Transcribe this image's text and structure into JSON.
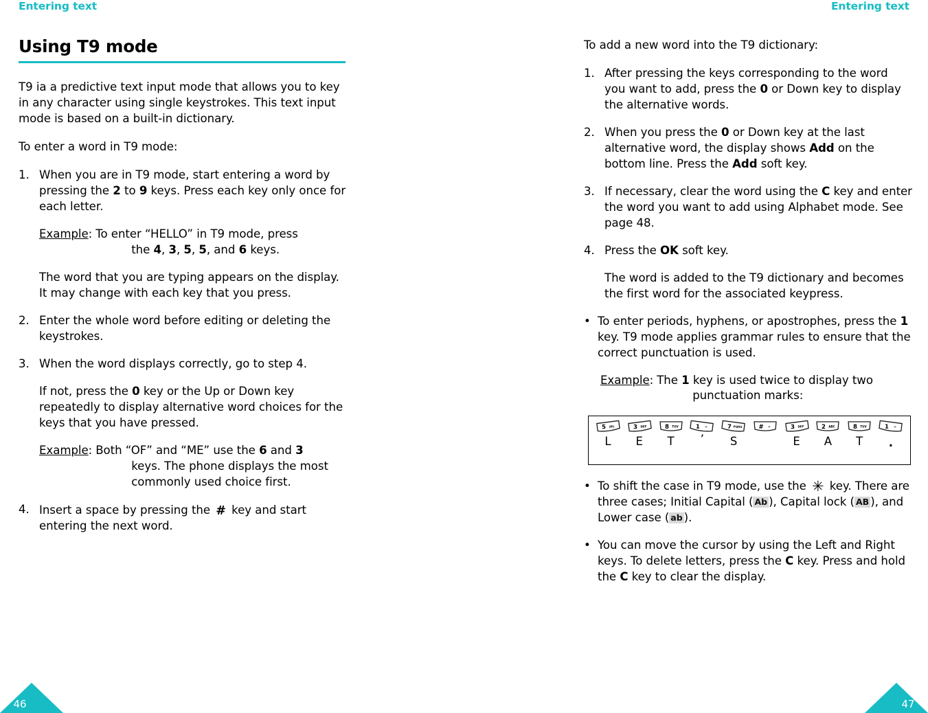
{
  "colors": {
    "accent_teal": "#17bcc4",
    "text_black": "#000000",
    "badge_gray": "#d9d9d9"
  },
  "left_page": {
    "running_head": "Entering text",
    "page_number": "46",
    "title": "Using T9 mode",
    "intro_paragraph": "T9 ia a predictive text input mode that allows you to key in any character using single keystrokes. This text input mode is based on a built-in dictionary.",
    "lead_in": "To enter a word in T9 mode:",
    "steps": [
      {
        "marker": "1.",
        "text_parts": [
          {
            "t": "When you are in T9 mode, start entering a word by pressing the ",
            "b": false
          },
          {
            "t": "2",
            "b": true
          },
          {
            "t": " to ",
            "b": false
          },
          {
            "t": "9",
            "b": true
          },
          {
            "t": " keys. Press each key only once for each letter.",
            "b": false
          }
        ]
      },
      {
        "marker": "2.",
        "text_parts": [
          {
            "t": "Enter the whole word before editing or deleting the keystrokes.",
            "b": false
          }
        ]
      },
      {
        "marker": "3.",
        "text_parts": [
          {
            "t": "When the word displays correctly, go to step 4.",
            "b": false
          }
        ]
      },
      {
        "marker": "4.",
        "text_parts": [
          {
            "t": "Insert a space by pressing the ",
            "b": false
          },
          {
            "t": "#",
            "b": true,
            "glyph": "hash-key-icon"
          },
          {
            "t": " key and start entering the next word.",
            "b": false
          }
        ]
      }
    ],
    "example_1": {
      "label": "Example",
      "label_suffix": ":",
      "line1_parts": [
        {
          "t": "To enter “HELLO” in T9 mode, press",
          "b": false
        }
      ],
      "line2_parts": [
        {
          "t": "the ",
          "b": false
        },
        {
          "t": "4",
          "b": true
        },
        {
          "t": ", ",
          "b": false
        },
        {
          "t": "3",
          "b": true
        },
        {
          "t": ", ",
          "b": false
        },
        {
          "t": "5",
          "b": true
        },
        {
          "t": ", ",
          "b": false
        },
        {
          "t": "5",
          "b": true
        },
        {
          "t": ", and ",
          "b": false
        },
        {
          "t": "6",
          "b": true
        },
        {
          "t": " keys.",
          "b": false
        }
      ]
    },
    "after_example_1": "The word that you are typing appears on the display. It may change with each key that you press.",
    "step3_continuation_parts": [
      {
        "t": "If not, press the ",
        "b": false
      },
      {
        "t": "0",
        "b": true
      },
      {
        "t": " key or the Up or Down key repeatedly to display alternative word choices for the keys that you have pressed.",
        "b": false
      }
    ],
    "example_2": {
      "label": "Example",
      "label_suffix": ":",
      "line1_parts": [
        {
          "t": "Both “OF” and “ME” use the ",
          "b": false
        },
        {
          "t": "6",
          "b": true
        },
        {
          "t": " and ",
          "b": false
        },
        {
          "t": "3",
          "b": true
        }
      ],
      "line2_parts": [
        {
          "t": "keys. The phone displays the most",
          "b": false
        }
      ],
      "line3_parts": [
        {
          "t": "commonly used choice first.",
          "b": false
        }
      ]
    }
  },
  "right_page": {
    "running_head": "Entering text",
    "page_number": "47",
    "lead_in": "To add a new word into the T9 dictionary:",
    "steps": [
      {
        "marker": "1.",
        "text_parts": [
          {
            "t": "After pressing the keys corresponding to the word you want to add, press the ",
            "b": false
          },
          {
            "t": "0",
            "b": true
          },
          {
            "t": " or Down key to display the alternative words.",
            "b": false
          }
        ]
      },
      {
        "marker": "2.",
        "text_parts": [
          {
            "t": "When you press the ",
            "b": false
          },
          {
            "t": "0",
            "b": true
          },
          {
            "t": " or Down key at the last alternative word, the display shows ",
            "b": false
          },
          {
            "t": "Add",
            "b": true
          },
          {
            "t": " on the bottom line. Press the ",
            "b": false
          },
          {
            "t": "Add",
            "b": true
          },
          {
            "t": " soft key.",
            "b": false
          }
        ]
      },
      {
        "marker": "3.",
        "text_parts": [
          {
            "t": "If necessary, clear the word using the ",
            "b": false
          },
          {
            "t": "C",
            "b": true
          },
          {
            "t": " key and enter the word you want to add using Alphabet mode. See page 48.",
            "b": false
          }
        ]
      },
      {
        "marker": "4.",
        "text_parts": [
          {
            "t": "Press the ",
            "b": false
          },
          {
            "t": "OK",
            "b": true
          },
          {
            "t": " soft key.",
            "b": false
          }
        ]
      }
    ],
    "step4_continuation": "The word is added to the T9 dictionary and becomes the first word for the associated keypress.",
    "bullets": [
      {
        "marker": "•",
        "text_parts": [
          {
            "t": "To enter periods, hyphens, or apostrophes, press the ",
            "b": false
          },
          {
            "t": "1",
            "b": true
          },
          {
            "t": " key. T9 mode applies grammar rules to ensure that the correct punctuation is used.",
            "b": false
          }
        ]
      }
    ],
    "example_3": {
      "label": "Example",
      "label_suffix": ":",
      "line1_parts": [
        {
          "t": "The ",
          "b": false
        },
        {
          "t": "1",
          "b": true
        },
        {
          "t": " key is used twice to display two",
          "b": false
        }
      ],
      "line2_parts": [
        {
          "t": "punctuation marks:",
          "b": false
        }
      ]
    },
    "key_sequence_figure": {
      "caption_phrase": "LET'S EAT.",
      "keys": [
        {
          "digit": "5",
          "sub": "JKL",
          "letter": "L",
          "shape": "left"
        },
        {
          "digit": "3",
          "sub": "DEF",
          "letter": "E",
          "shape": "left"
        },
        {
          "digit": "8",
          "sub": "TUV",
          "letter": "T",
          "shape": "flat"
        },
        {
          "digit": "1",
          "sub": "∞",
          "letter": "’",
          "shape": "right"
        },
        {
          "digit": "7",
          "sub": "PQRS",
          "letter": "S",
          "shape": "right"
        },
        {
          "digit": "#",
          "sub": "↵",
          "letter": "",
          "shape": "flat"
        },
        {
          "digit": "3",
          "sub": "DEF",
          "letter": "E",
          "shape": "left"
        },
        {
          "digit": "2",
          "sub": "ABC",
          "letter": "A",
          "shape": "flat"
        },
        {
          "digit": "8",
          "sub": "TUV",
          "letter": "T",
          "shape": "flat"
        },
        {
          "digit": "1",
          "sub": "∞",
          "letter": ".",
          "shape": "right"
        }
      ]
    },
    "case_bullet": {
      "marker": "•",
      "part_1": "To shift the case in T9 mode, use the ",
      "star_glyph": "✳",
      "part_2": " key. There are three cases; Initial Capital (",
      "badge_1": "Ab",
      "part_3": "), Capital lock (",
      "badge_2": "AB",
      "part_4": "), and Lower case (",
      "badge_3": "ab",
      "part_5": ")."
    },
    "cursor_bullet": {
      "marker": "•",
      "text_parts": [
        {
          "t": "You can move the cursor by using the Left and Right keys. To delete letters, press the ",
          "b": false
        },
        {
          "t": "C",
          "b": true
        },
        {
          "t": " key. Press and hold the ",
          "b": false
        },
        {
          "t": "C",
          "b": true
        },
        {
          "t": " key to clear the display.",
          "b": false
        }
      ]
    }
  }
}
